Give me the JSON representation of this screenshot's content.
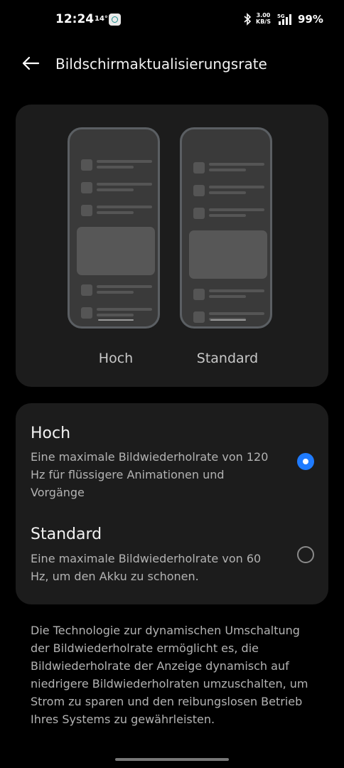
{
  "status_bar": {
    "time": "12:24",
    "temperature": "14°",
    "speed_value": "3.00",
    "speed_unit": "KB/S",
    "network": "5G",
    "battery": "99%"
  },
  "header": {
    "title": "Bildschirmaktualisierungsrate"
  },
  "preview": {
    "labels": [
      "Hoch",
      "Standard"
    ]
  },
  "options": [
    {
      "title": "Hoch",
      "description": "Eine maximale Bildwiederholrate von 120 Hz für flüssigere Animationen und Vorgänge",
      "selected": true
    },
    {
      "title": "Standard",
      "description": "Eine maximale Bildwiederholrate von 60 Hz, um den Akku zu schonen.",
      "selected": false
    }
  ],
  "footnote": "Die Technologie zur dynamischen Umschaltung der Bildwiederholrate ermöglicht es, die Bildwiederholrate der Anzeige dynamisch auf niedrigere Bildwiederholraten umzuschalten, um Strom zu sparen und den reibungslosen Betrieb Ihres Systems zu gewährleisten.",
  "colors": {
    "accent": "#1f7bff",
    "card": "#1c1c1c",
    "background": "#000000"
  }
}
